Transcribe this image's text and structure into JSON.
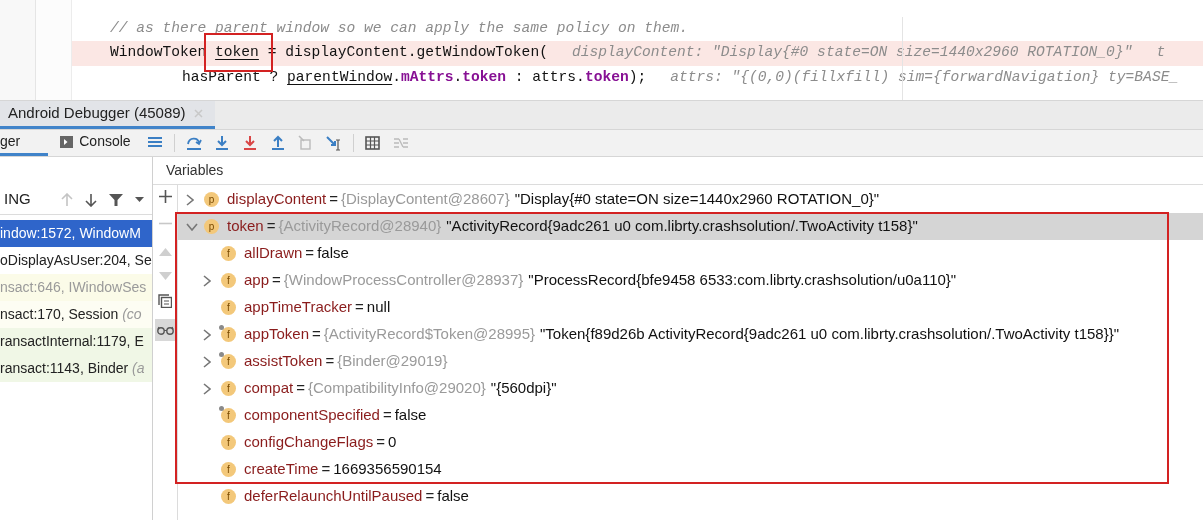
{
  "editor": {
    "lines": [
      {
        "kind": "code",
        "highlighted": false,
        "segments": [
          {
            "text": "// as there parent window so we can apply the same policy on them.",
            "kind": "comment"
          }
        ]
      },
      {
        "kind": "code",
        "highlighted": true,
        "segments": [
          {
            "text": "WindowToken ",
            "kind": "plain"
          },
          {
            "text": "token",
            "kind": "underline",
            "boxed": true
          },
          {
            "text": " = displayContent.getWindowToken(",
            "kind": "plain"
          },
          {
            "text": "displayContent: \"Display{#0 state=ON size=1440x2960 ROTATION_0}\"",
            "kind": "hint"
          },
          {
            "text": "t",
            "kind": "hint"
          }
        ]
      },
      {
        "kind": "continuation",
        "highlighted": false,
        "segments": [
          {
            "text": "hasParent ? ",
            "kind": "plain"
          },
          {
            "text": "parentWindow",
            "kind": "underline"
          },
          {
            "text": ".",
            "kind": "plain"
          },
          {
            "text": "mAttrs",
            "kind": "field"
          },
          {
            "text": ".",
            "kind": "plain"
          },
          {
            "text": "token",
            "kind": "field"
          },
          {
            "text": " : attrs.",
            "kind": "plain"
          },
          {
            "text": "token",
            "kind": "field"
          },
          {
            "text": ");",
            "kind": "plain"
          },
          {
            "text": "attrs: \"{(0,0)(fillxfill) sim={forwardNavigation} ty=BASE_",
            "kind": "hint"
          }
        ]
      }
    ]
  },
  "tool_window": {
    "title": "Android Debugger (45089)",
    "tabs": [
      {
        "label": "ger",
        "selected": true
      },
      {
        "label": "Console",
        "selected": false
      }
    ],
    "frames_panel": {
      "thread": "ING",
      "frames": [
        {
          "text": "indow:1572, WindowM",
          "selected": true,
          "dimmed": false,
          "color": "#2f65ca"
        },
        {
          "text": "oDisplayAsUser:204, Se",
          "selected": false,
          "dimmed": false,
          "color": "#ffffff"
        },
        {
          "text": "nsact:646, IWindowSes",
          "selected": false,
          "dimmed": true,
          "color": "#fbfbe8"
        },
        {
          "text": "nsact:170, Session ",
          "note": "(co",
          "selected": false,
          "dimmed": false,
          "color": "#fdfdf3"
        },
        {
          "text": "ransactInternal:1179, E",
          "selected": false,
          "dimmed": false,
          "color": "#f0f7e6"
        },
        {
          "text": "ransact:1143, Binder ",
          "note": "(a",
          "selected": false,
          "dimmed": false,
          "color": "#f0f7e6"
        }
      ]
    },
    "variables": {
      "title": "Variables",
      "items": [
        {
          "badge": "p",
          "name": "displayContent",
          "sign": "=",
          "type": "{DisplayContent@28607}",
          "value": "\"Display{#0 state=ON size=1440x2960 ROTATION_0}\"",
          "expanded": false,
          "selected": false,
          "framed": false,
          "marked": false
        },
        {
          "badge": "p",
          "name": "token",
          "sign": "=",
          "type": "{ActivityRecord@28940}",
          "value": "\"ActivityRecord{9adc261 u0 com.librty.crashsolution/.TwoActivity t158}\"",
          "expanded": true,
          "selected": true,
          "framed": true,
          "marked": false,
          "children": [
            {
              "badge": "f",
              "name": "allDrawn",
              "sign": "=",
              "value": "false",
              "selected": false,
              "framed": true,
              "marked": false
            },
            {
              "badge": "f",
              "name": "app",
              "sign": "=",
              "type": "{WindowProcessController@28937}",
              "value": "\"ProcessRecord{bfe9458 6533:com.librty.crashsolution/u0a110}\"",
              "expanded": false,
              "selected": false,
              "framed": true,
              "marked": false
            },
            {
              "badge": "f",
              "name": "appTimeTracker",
              "sign": "=",
              "value": "null",
              "selected": false,
              "framed": true,
              "marked": false
            },
            {
              "badge": "f",
              "name": "appToken",
              "sign": "=",
              "type": "{ActivityRecord$Token@28995}",
              "value": "\"Token{f89d26b ActivityRecord{9adc261 u0 com.librty.crashsolution/.TwoActivity t158}}\"",
              "expanded": false,
              "selected": false,
              "framed": true,
              "marked": true
            },
            {
              "badge": "f",
              "name": "assistToken",
              "sign": "=",
              "type": "{Binder@29019}",
              "expanded": false,
              "selected": false,
              "framed": true,
              "marked": true
            },
            {
              "badge": "f",
              "name": "compat",
              "sign": "=",
              "type": "{CompatibilityInfo@29020}",
              "value": "\"{560dpi}\"",
              "expanded": false,
              "selected": false,
              "framed": true,
              "marked": false
            },
            {
              "badge": "f",
              "name": "componentSpecified",
              "sign": "=",
              "value": "false",
              "selected": false,
              "framed": true,
              "marked": true
            },
            {
              "badge": "f",
              "name": "configChangeFlags",
              "sign": "=",
              "value": "0",
              "selected": false,
              "framed": true,
              "marked": false
            },
            {
              "badge": "f",
              "name": "createTime",
              "sign": "=",
              "value": "1669356590154",
              "selected": false,
              "framed": true,
              "marked": false
            },
            {
              "badge": "f",
              "name": "deferRelaunchUntilPaused",
              "sign": "=",
              "value": "false",
              "selected": false,
              "framed": false,
              "marked": false
            }
          ]
        }
      ]
    }
  }
}
